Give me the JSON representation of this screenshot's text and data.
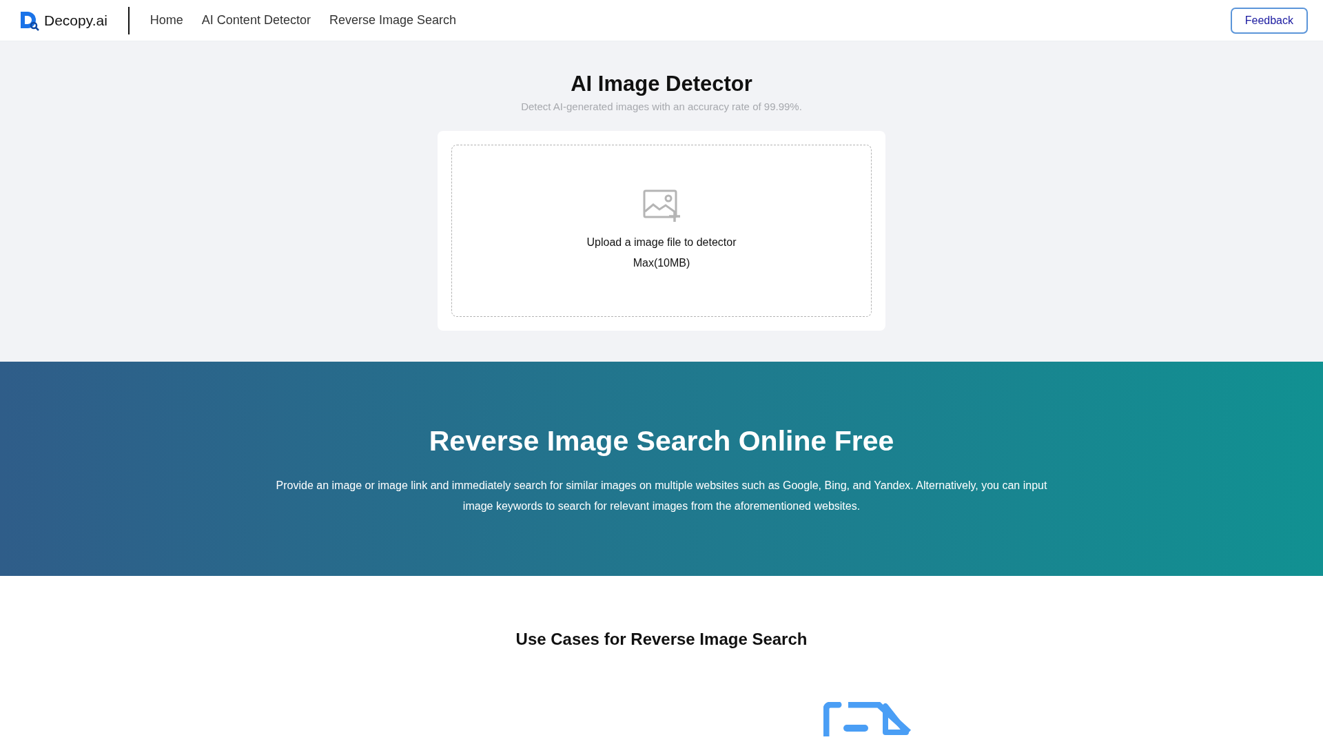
{
  "header": {
    "logo": "Decopy.ai",
    "nav": [
      {
        "label": "Home"
      },
      {
        "label": "AI Content Detector"
      },
      {
        "label": "Reverse Image Search"
      }
    ],
    "feedback": "Feedback"
  },
  "detector": {
    "title": "AI Image Detector",
    "subtitle": "Detect AI-generated images with an accuracy rate of 99.99%.",
    "upload_text": "Upload a image file to detector",
    "max_size": "Max(10MB)"
  },
  "banner": {
    "title": "Reverse Image Search Online Free",
    "description": "Provide an image or image link and immediately search for similar images on multiple websites such as Google, Bing, and Yandex. Alternatively, you can input image keywords to search for relevant images from the aforementioned websites."
  },
  "use_cases": {
    "title": "Use Cases for Reverse Image Search"
  }
}
